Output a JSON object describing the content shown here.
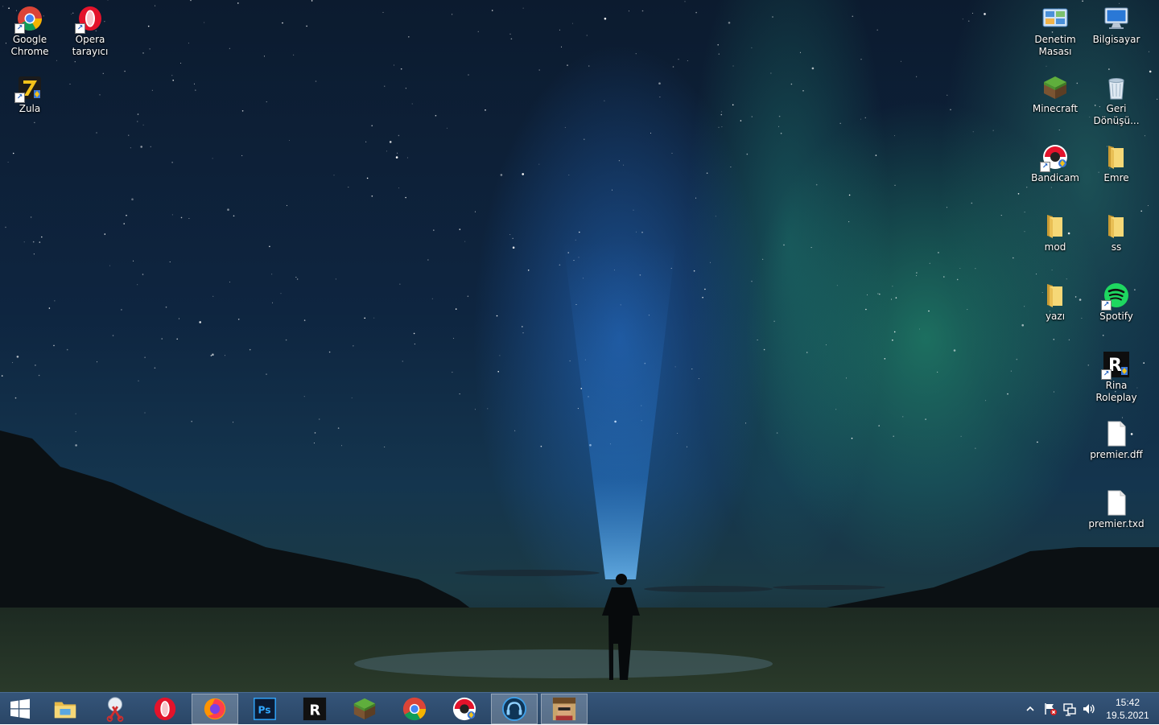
{
  "desktop": {
    "icons_left": [
      {
        "label": "Google Chrome",
        "icon": "chrome-icon"
      },
      {
        "label": "Opera tarayıcı",
        "icon": "opera-icon"
      },
      {
        "label": "Zula",
        "icon": "zula-icon"
      }
    ],
    "icons_right": [
      {
        "label": "Denetim Masası",
        "icon": "control-panel-icon"
      },
      {
        "label": "Bilgisayar",
        "icon": "computer-icon"
      },
      {
        "label": "Minecraft",
        "icon": "minecraft-icon"
      },
      {
        "label": "Geri Dönüşü...",
        "icon": "recycle-bin-icon"
      },
      {
        "label": "Bandicam",
        "icon": "bandicam-icon"
      },
      {
        "label": "Emre",
        "icon": "folder-icon"
      },
      {
        "label": "mod",
        "icon": "folder-icon"
      },
      {
        "label": "ss",
        "icon": "folder-icon"
      },
      {
        "label": "yazı",
        "icon": "folder-icon"
      },
      {
        "label": "Spotify",
        "icon": "spotify-icon"
      },
      {
        "label": "Rina Roleplay",
        "icon": "rina-roleplay-icon"
      },
      {
        "label": "premier.dff",
        "icon": "file-icon"
      },
      {
        "label": "premier.txd",
        "icon": "file-icon"
      }
    ]
  },
  "taskbar": {
    "start_icon": "windows-start-icon",
    "pinned": [
      {
        "icon": "file-explorer-icon"
      },
      {
        "icon": "snipping-tool-icon"
      },
      {
        "icon": "opera-icon"
      },
      {
        "icon": "firefox-icon",
        "active": true
      },
      {
        "icon": "photoshop-icon",
        "text": "Ps"
      },
      {
        "icon": "rockstar-launcher-icon",
        "text": "R"
      },
      {
        "icon": "minecraft-icon"
      },
      {
        "icon": "chrome-icon"
      },
      {
        "icon": "bandicam-icon"
      },
      {
        "icon": "headset-app-icon",
        "active": true
      },
      {
        "icon": "game-avatar-icon",
        "active": true
      }
    ],
    "tray": {
      "time": "15:42",
      "date": "19.5.2021",
      "icons": [
        "chevron-up-icon",
        "flag-error-icon",
        "network-icon",
        "volume-icon"
      ]
    }
  },
  "colors": {
    "taskbar": "#2d4a6b",
    "folder": "#e8c466",
    "sky_top": "#0c1b2f"
  }
}
